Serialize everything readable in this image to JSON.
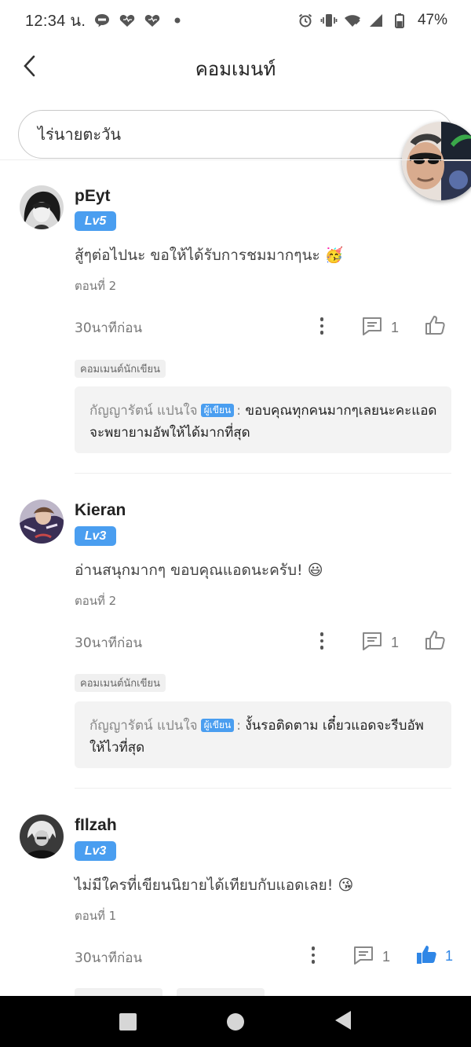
{
  "status_bar": {
    "time": "12:34 น.",
    "battery": "47%",
    "icons": [
      "line-icon",
      "heart-icon",
      "heart-icon",
      "dot-icon",
      "alarm-icon",
      "vibrate-icon",
      "wifi-icon",
      "signal-icon",
      "battery-icon"
    ]
  },
  "header": {
    "title": "คอมเมนท์",
    "back_icon": "chevron-left-icon"
  },
  "story": {
    "title": "ไร่นายตะวัน"
  },
  "comments": [
    {
      "username": "pEyt",
      "level": "Lv5",
      "text": "สู้ๆต่อไปนะ ขอให้ได้รับการชมมากๆนะ 🥳",
      "chapter": "ตอนที่ 2",
      "time": "30นาทีก่อน",
      "reply_count": "1",
      "like_count": "",
      "liked": false,
      "author_tag": "คอมเมนต์นักเขียน",
      "author_reply": {
        "author": "กัญญารัตน์ แปนใจ",
        "badge": "ผู้เขียน",
        "separator": ":",
        "text": "ขอบคุณทุกคนมากๆเลยนะคะแอดจะพยายามอัพให้ได้มากที่สุด"
      }
    },
    {
      "username": "Kieran",
      "level": "Lv3",
      "text": "อ่านสนุกมากๆ ขอบคุณแอดนะครับ! 😃",
      "chapter": "ตอนที่ 2",
      "time": "30นาทีก่อน",
      "reply_count": "1",
      "like_count": "",
      "liked": false,
      "author_tag": "คอมเมนต์นักเขียน",
      "author_reply": {
        "author": "กัญญารัตน์ แปนใจ",
        "badge": "ผู้เขียน",
        "separator": ":",
        "text": "งั้นรอติดตาม เดี๋ยวแอดจะรีบอัพให้ไวที่สุด"
      }
    },
    {
      "username": "fIlzah",
      "level": "Lv3",
      "text": "ไม่มีใครที่เขียนนิยายได้เทียบกับแอดเลย! 😘",
      "chapter": "ตอนที่ 1",
      "time": "30นาทีก่อน",
      "reply_count": "1",
      "like_count": "1",
      "liked": true
    }
  ],
  "colors": {
    "accent": "#4a9ef0",
    "like_active": "#2f86e6",
    "nav_bar": "#000000"
  }
}
